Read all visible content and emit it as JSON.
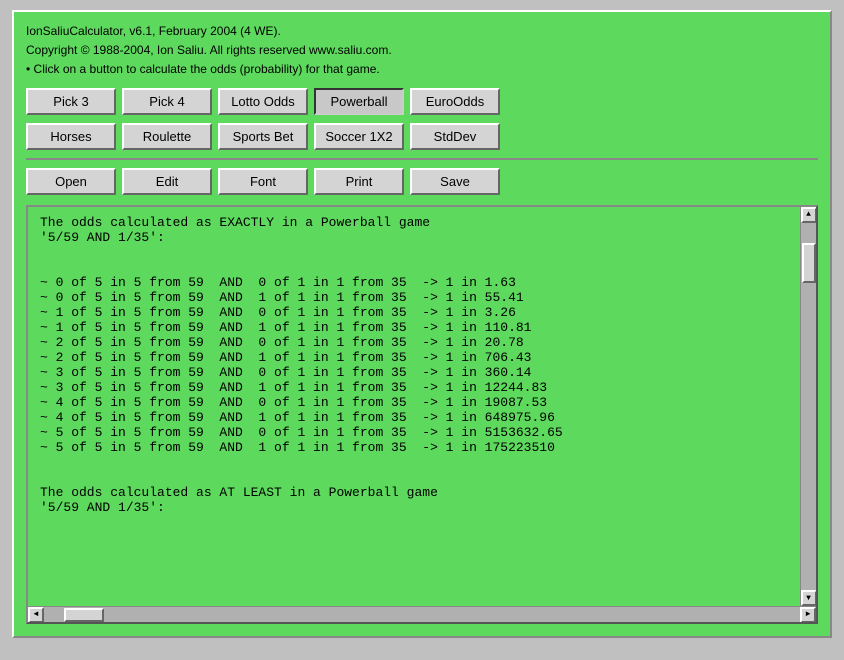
{
  "window": {
    "title_line1": "IonSaliuCalculator, v6.1, February 2004 (4 WE).",
    "title_line2": "Copyright © 1988-2004, Ion Saliu. All rights reserved www.saliu.com.",
    "title_line3": "• Click on a button to calculate the odds (probability) for that game."
  },
  "buttons_row1": [
    {
      "label": "Pick 3",
      "name": "pick3-button",
      "active": false
    },
    {
      "label": "Pick 4",
      "name": "pick4-button",
      "active": false
    },
    {
      "label": "Lotto Odds",
      "name": "lotto-odds-button",
      "active": false
    },
    {
      "label": "Powerball",
      "name": "powerball-button",
      "active": true
    },
    {
      "label": "EuroOdds",
      "name": "euroodds-button",
      "active": false
    }
  ],
  "buttons_row2": [
    {
      "label": "Horses",
      "name": "horses-button",
      "active": false
    },
    {
      "label": "Roulette",
      "name": "roulette-button",
      "active": false
    },
    {
      "label": "Sports Bet",
      "name": "sports-bet-button",
      "active": false
    },
    {
      "label": "Soccer 1X2",
      "name": "soccer-button",
      "active": false
    },
    {
      "label": "StdDev",
      "name": "stddev-button",
      "active": false
    }
  ],
  "buttons_row3": [
    {
      "label": "Open",
      "name": "open-button",
      "active": false
    },
    {
      "label": "Edit",
      "name": "edit-button",
      "active": false
    },
    {
      "label": "Font",
      "name": "font-button",
      "active": false
    },
    {
      "label": "Print",
      "name": "print-button",
      "active": false
    },
    {
      "label": "Save",
      "name": "save-button",
      "active": false
    }
  ],
  "output": {
    "content": "The odds calculated as EXACTLY in a Powerball game\n'5/59 AND 1/35':\n\n\n~ 0 of 5 in 5 from 59  AND  0 of 1 in 1 from 35  -> 1 in 1.63\n~ 0 of 5 in 5 from 59  AND  1 of 1 in 1 from 35  -> 1 in 55.41\n~ 1 of 5 in 5 from 59  AND  0 of 1 in 1 from 35  -> 1 in 3.26\n~ 1 of 5 in 5 from 59  AND  1 of 1 in 1 from 35  -> 1 in 110.81\n~ 2 of 5 in 5 from 59  AND  0 of 1 in 1 from 35  -> 1 in 20.78\n~ 2 of 5 in 5 from 59  AND  1 of 1 in 1 from 35  -> 1 in 706.43\n~ 3 of 5 in 5 from 59  AND  0 of 1 in 1 from 35  -> 1 in 360.14\n~ 3 of 5 in 5 from 59  AND  1 of 1 in 1 from 35  -> 1 in 12244.83\n~ 4 of 5 in 5 from 59  AND  0 of 1 in 1 from 35  -> 1 in 19087.53\n~ 4 of 5 in 5 from 59  AND  1 of 1 in 1 from 35  -> 1 in 648975.96\n~ 5 of 5 in 5 from 59  AND  0 of 1 in 1 from 35  -> 1 in 5153632.65\n~ 5 of 5 in 5 from 59  AND  1 of 1 in 1 from 35  -> 1 in 175223510\n\n\nThe odds calculated as AT LEAST in a Powerball game\n'5/59 AND 1/35':"
  },
  "scrollbar": {
    "up_arrow": "▲",
    "down_arrow": "▼",
    "left_arrow": "◄",
    "right_arrow": "►"
  }
}
